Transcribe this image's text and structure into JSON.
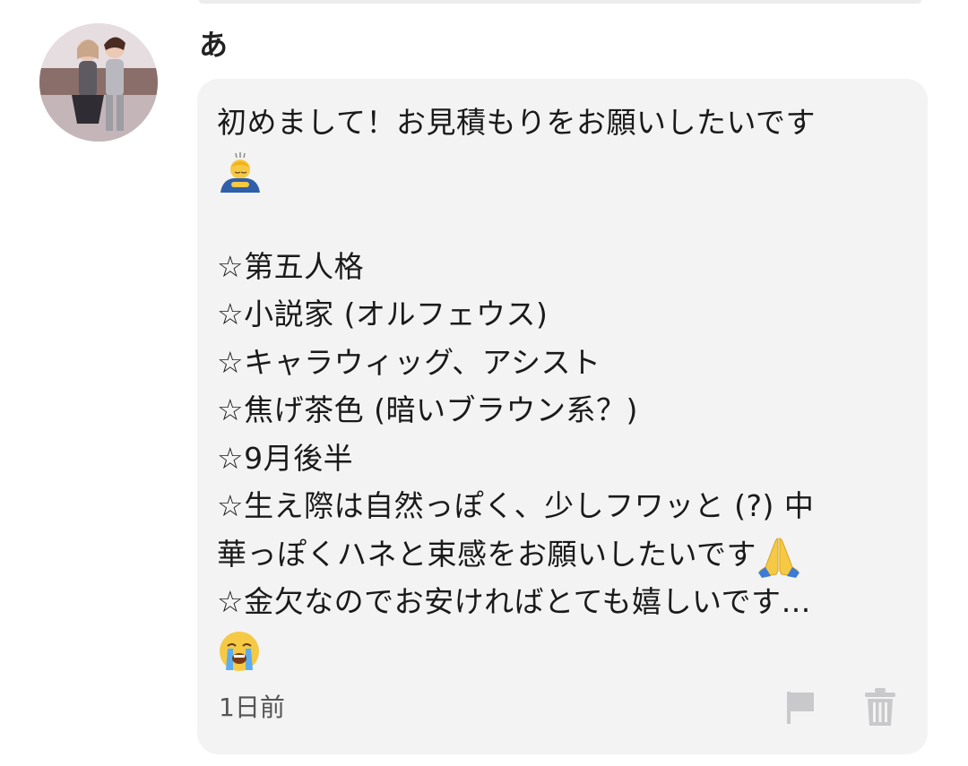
{
  "comment": {
    "username": "あ",
    "message_lines": [
      "初めまして！お見積もりをお願いしたいです",
      "",
      "",
      "☆第五人格",
      "☆小説家 (オルフェウス)",
      "☆キャラウィッグ、アシスト",
      "☆焦げ茶色 (暗いブラウン系？)",
      "☆9月後半",
      "☆生え際は自然っぽく、少しフワッと (?) 中",
      "華っぽくハネと束感をお願いしたいです",
      "☆金欠なのでお安ければとても嬉しいです…",
      ""
    ],
    "emojis": [
      "bowing-person-emoji",
      "folded-hands-emoji",
      "loudly-crying-face-emoji"
    ],
    "timestamp": "1日前",
    "actions": [
      "flag-icon",
      "trash-icon"
    ]
  },
  "colors": {
    "bubble_background": "#f3f3f4",
    "text": "#1a1a1a",
    "timestamp": "#555555",
    "icon": "#c9c9cc"
  }
}
